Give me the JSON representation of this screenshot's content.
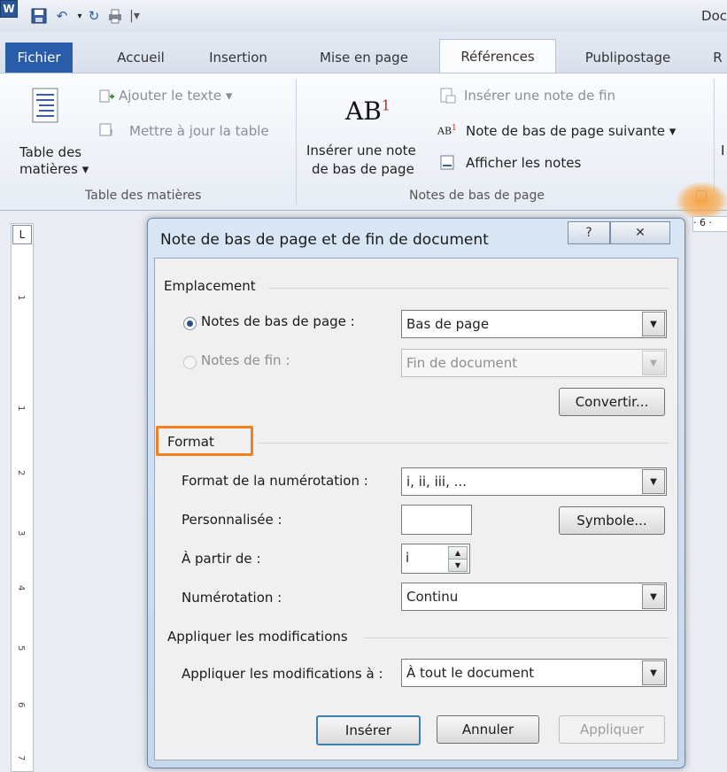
{
  "app": {
    "doc_title": "Doc",
    "logo_letter": "W"
  },
  "tabs": [
    "Fichier",
    "Accueil",
    "Insertion",
    "Mise en page",
    "Références",
    "Publipostage",
    "R"
  ],
  "ribbon": {
    "toc_label_1": "Table des",
    "toc_label_2": "matières ▾",
    "add_text": "Ajouter le texte ▾",
    "update_table": "Mettre à jour la table",
    "group1": "Table des matières",
    "ab_glyph": "AB",
    "ab_sup": "1",
    "insert_note_1": "Insérer une note",
    "insert_note_2": "de bas de page",
    "insert_endnote": "Insérer une note de fin",
    "next_footnote": "Note de bas de page suivante ▾",
    "show_notes": "Afficher les notes",
    "group2": "Notes de bas de page",
    "partial_right": "I"
  },
  "ruler": {
    "h_tick": "· 6 ·",
    "corner": "L",
    "v_marks": [
      "1",
      "1",
      "2",
      "3",
      "4",
      "5",
      "6",
      "7"
    ]
  },
  "dialog": {
    "title": "Note de bas de page et de fin de document",
    "help": "?",
    "close": "✕",
    "placement": {
      "section": "Emplacement",
      "footnotes_label": "Notes de bas de page :",
      "footnotes_value": "Bas de page",
      "endnotes_label": "Notes de fin :",
      "endnotes_value": "Fin de document",
      "convert": "Convertir..."
    },
    "format": {
      "section": "Format",
      "numbering_format_label": "Format de la numérotation :",
      "numbering_format_value": "i, ii, iii, ...",
      "custom_label": "Personnalisée :",
      "custom_value": "",
      "symbol": "Symbole...",
      "start_label": "À partir de :",
      "start_value": "i",
      "numbering_label": "Numérotation :",
      "numbering_value": "Continu"
    },
    "apply": {
      "section": "Appliquer les modifications",
      "apply_to_label": "Appliquer les modifications à :",
      "apply_to_value": "À tout le document"
    },
    "buttons": {
      "insert": "Insérer",
      "cancel": "Annuler",
      "apply": "Appliquer"
    }
  },
  "colors": {
    "file_tab": "#2a5da9",
    "highlight": "#f08020"
  }
}
